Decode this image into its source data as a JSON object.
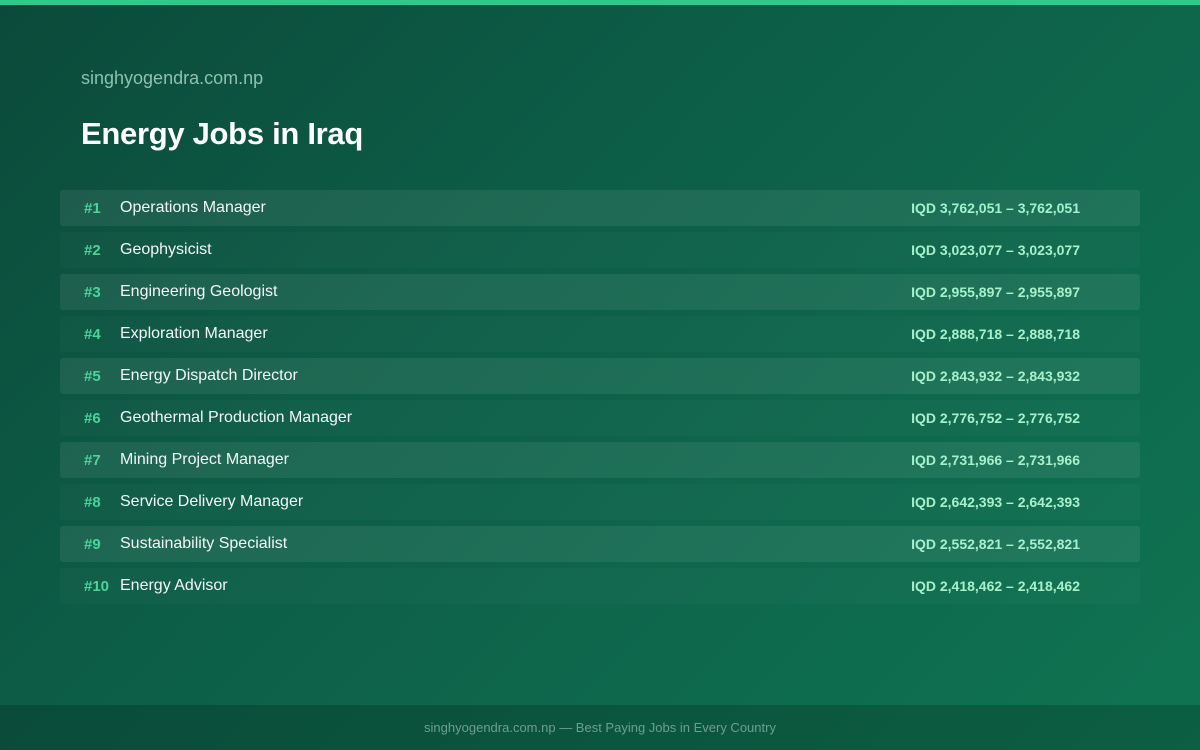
{
  "header": {
    "site_name": "singhyogendra.com.np",
    "title": "Energy Jobs in Iraq"
  },
  "colors": {
    "accent": "#2fc98a",
    "rank": "#49d59a",
    "salary": "#a8f0cc",
    "background_start": "#0b4a3a",
    "background_end": "#0f7452"
  },
  "jobs": [
    {
      "rank": "#1",
      "title": "Operations Manager",
      "salary": "IQD 3,762,051 – 3,762,051"
    },
    {
      "rank": "#2",
      "title": "Geophysicist",
      "salary": "IQD 3,023,077 – 3,023,077"
    },
    {
      "rank": "#3",
      "title": "Engineering Geologist",
      "salary": "IQD 2,955,897 – 2,955,897"
    },
    {
      "rank": "#4",
      "title": "Exploration Manager",
      "salary": "IQD 2,888,718 – 2,888,718"
    },
    {
      "rank": "#5",
      "title": "Energy Dispatch Director",
      "salary": "IQD 2,843,932 – 2,843,932"
    },
    {
      "rank": "#6",
      "title": "Geothermal Production Manager",
      "salary": "IQD 2,776,752 – 2,776,752"
    },
    {
      "rank": "#7",
      "title": "Mining Project Manager",
      "salary": "IQD 2,731,966 – 2,731,966"
    },
    {
      "rank": "#8",
      "title": "Service Delivery Manager",
      "salary": "IQD 2,642,393 – 2,642,393"
    },
    {
      "rank": "#9",
      "title": "Sustainability Specialist",
      "salary": "IQD 2,552,821 – 2,552,821"
    },
    {
      "rank": "#10",
      "title": "Energy Advisor",
      "salary": "IQD 2,418,462 – 2,418,462"
    }
  ],
  "footer": {
    "text": "singhyogendra.com.np — Best Paying Jobs in Every Country"
  }
}
